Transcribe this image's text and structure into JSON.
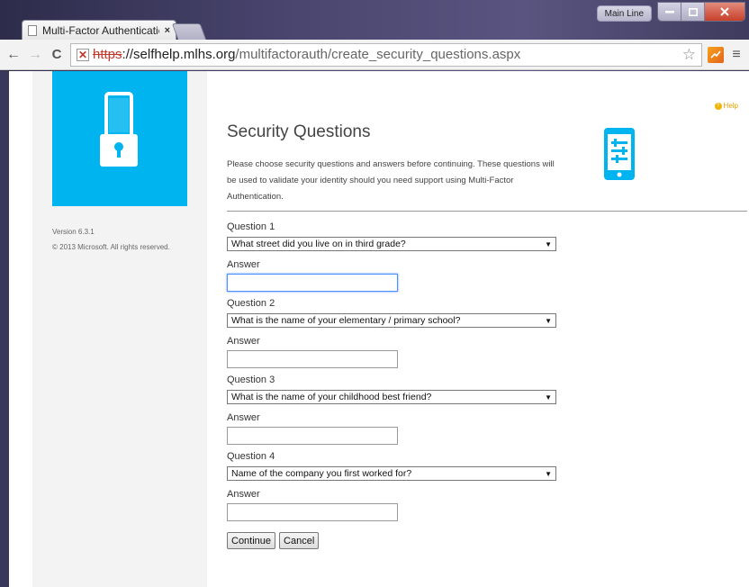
{
  "browser": {
    "tab_title": "Multi-Factor Authenticatic",
    "tab_close": "×",
    "profile_label": "Main Line",
    "url_scheme": "https",
    "url_host": "://selfhelp.mlhs.org",
    "url_path": "/multifactorauth/create_security_questions.aspx",
    "back_glyph": "←",
    "forward_glyph": "→",
    "reload_glyph": "C",
    "star_glyph": "☆",
    "menu_glyph": "≡",
    "icons": [
      "page-icon",
      "back-icon",
      "forward-icon",
      "reload-icon",
      "insecure-icon",
      "star-icon",
      "extension-icon",
      "menu-icon"
    ]
  },
  "sidebar": {
    "version": "Version 6.3.1",
    "copyright": "© 2013 Microsoft. All rights reserved.",
    "logo_color": "#00b4f0"
  },
  "main": {
    "help_label": "Help",
    "title": "Security Questions",
    "intro": "Please choose security questions and answers before continuing. These questions will be used to validate your identity should you need support using Multi-Factor Authentication.",
    "questions": [
      {
        "label": "Question 1",
        "selected": "What street did you live on in third grade?",
        "answer_label": "Answer",
        "answer": ""
      },
      {
        "label": "Question 2",
        "selected": "What is the name of your elementary / primary school?",
        "answer_label": "Answer",
        "answer": ""
      },
      {
        "label": "Question 3",
        "selected": "What is the name of your childhood best friend?",
        "answer_label": "Answer",
        "answer": ""
      },
      {
        "label": "Question 4",
        "selected": "Name of the company you first worked for?",
        "answer_label": "Answer",
        "answer": ""
      }
    ],
    "continue_label": "Continue",
    "cancel_label": "Cancel",
    "accent_color": "#00b4f0"
  }
}
